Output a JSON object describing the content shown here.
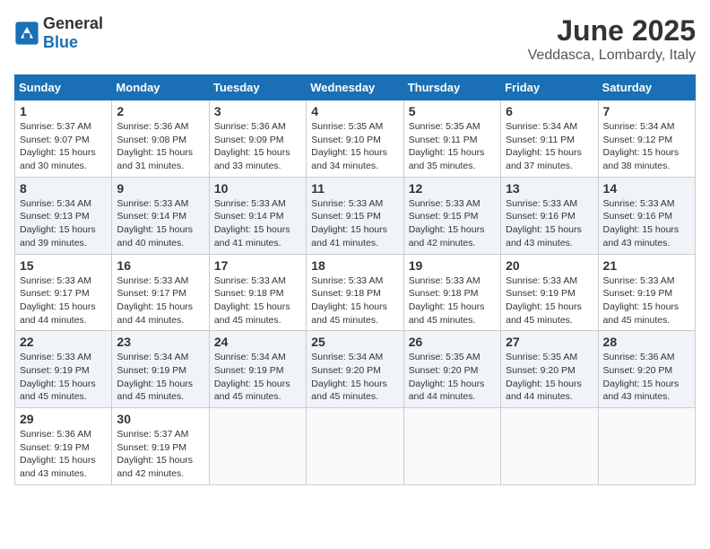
{
  "logo": {
    "general": "General",
    "blue": "Blue"
  },
  "title": {
    "month": "June 2025",
    "location": "Veddasca, Lombardy, Italy"
  },
  "calendar": {
    "headers": [
      "Sunday",
      "Monday",
      "Tuesday",
      "Wednesday",
      "Thursday",
      "Friday",
      "Saturday"
    ],
    "weeks": [
      [
        {
          "day": "1",
          "sunrise": "Sunrise: 5:37 AM",
          "sunset": "Sunset: 9:07 PM",
          "daylight": "Daylight: 15 hours and 30 minutes."
        },
        {
          "day": "2",
          "sunrise": "Sunrise: 5:36 AM",
          "sunset": "Sunset: 9:08 PM",
          "daylight": "Daylight: 15 hours and 31 minutes."
        },
        {
          "day": "3",
          "sunrise": "Sunrise: 5:36 AM",
          "sunset": "Sunset: 9:09 PM",
          "daylight": "Daylight: 15 hours and 33 minutes."
        },
        {
          "day": "4",
          "sunrise": "Sunrise: 5:35 AM",
          "sunset": "Sunset: 9:10 PM",
          "daylight": "Daylight: 15 hours and 34 minutes."
        },
        {
          "day": "5",
          "sunrise": "Sunrise: 5:35 AM",
          "sunset": "Sunset: 9:11 PM",
          "daylight": "Daylight: 15 hours and 35 minutes."
        },
        {
          "day": "6",
          "sunrise": "Sunrise: 5:34 AM",
          "sunset": "Sunset: 9:11 PM",
          "daylight": "Daylight: 15 hours and 37 minutes."
        },
        {
          "day": "7",
          "sunrise": "Sunrise: 5:34 AM",
          "sunset": "Sunset: 9:12 PM",
          "daylight": "Daylight: 15 hours and 38 minutes."
        }
      ],
      [
        {
          "day": "8",
          "sunrise": "Sunrise: 5:34 AM",
          "sunset": "Sunset: 9:13 PM",
          "daylight": "Daylight: 15 hours and 39 minutes."
        },
        {
          "day": "9",
          "sunrise": "Sunrise: 5:33 AM",
          "sunset": "Sunset: 9:14 PM",
          "daylight": "Daylight: 15 hours and 40 minutes."
        },
        {
          "day": "10",
          "sunrise": "Sunrise: 5:33 AM",
          "sunset": "Sunset: 9:14 PM",
          "daylight": "Daylight: 15 hours and 41 minutes."
        },
        {
          "day": "11",
          "sunrise": "Sunrise: 5:33 AM",
          "sunset": "Sunset: 9:15 PM",
          "daylight": "Daylight: 15 hours and 41 minutes."
        },
        {
          "day": "12",
          "sunrise": "Sunrise: 5:33 AM",
          "sunset": "Sunset: 9:15 PM",
          "daylight": "Daylight: 15 hours and 42 minutes."
        },
        {
          "day": "13",
          "sunrise": "Sunrise: 5:33 AM",
          "sunset": "Sunset: 9:16 PM",
          "daylight": "Daylight: 15 hours and 43 minutes."
        },
        {
          "day": "14",
          "sunrise": "Sunrise: 5:33 AM",
          "sunset": "Sunset: 9:16 PM",
          "daylight": "Daylight: 15 hours and 43 minutes."
        }
      ],
      [
        {
          "day": "15",
          "sunrise": "Sunrise: 5:33 AM",
          "sunset": "Sunset: 9:17 PM",
          "daylight": "Daylight: 15 hours and 44 minutes."
        },
        {
          "day": "16",
          "sunrise": "Sunrise: 5:33 AM",
          "sunset": "Sunset: 9:17 PM",
          "daylight": "Daylight: 15 hours and 44 minutes."
        },
        {
          "day": "17",
          "sunrise": "Sunrise: 5:33 AM",
          "sunset": "Sunset: 9:18 PM",
          "daylight": "Daylight: 15 hours and 45 minutes."
        },
        {
          "day": "18",
          "sunrise": "Sunrise: 5:33 AM",
          "sunset": "Sunset: 9:18 PM",
          "daylight": "Daylight: 15 hours and 45 minutes."
        },
        {
          "day": "19",
          "sunrise": "Sunrise: 5:33 AM",
          "sunset": "Sunset: 9:18 PM",
          "daylight": "Daylight: 15 hours and 45 minutes."
        },
        {
          "day": "20",
          "sunrise": "Sunrise: 5:33 AM",
          "sunset": "Sunset: 9:19 PM",
          "daylight": "Daylight: 15 hours and 45 minutes."
        },
        {
          "day": "21",
          "sunrise": "Sunrise: 5:33 AM",
          "sunset": "Sunset: 9:19 PM",
          "daylight": "Daylight: 15 hours and 45 minutes."
        }
      ],
      [
        {
          "day": "22",
          "sunrise": "Sunrise: 5:33 AM",
          "sunset": "Sunset: 9:19 PM",
          "daylight": "Daylight: 15 hours and 45 minutes."
        },
        {
          "day": "23",
          "sunrise": "Sunrise: 5:34 AM",
          "sunset": "Sunset: 9:19 PM",
          "daylight": "Daylight: 15 hours and 45 minutes."
        },
        {
          "day": "24",
          "sunrise": "Sunrise: 5:34 AM",
          "sunset": "Sunset: 9:19 PM",
          "daylight": "Daylight: 15 hours and 45 minutes."
        },
        {
          "day": "25",
          "sunrise": "Sunrise: 5:34 AM",
          "sunset": "Sunset: 9:20 PM",
          "daylight": "Daylight: 15 hours and 45 minutes."
        },
        {
          "day": "26",
          "sunrise": "Sunrise: 5:35 AM",
          "sunset": "Sunset: 9:20 PM",
          "daylight": "Daylight: 15 hours and 44 minutes."
        },
        {
          "day": "27",
          "sunrise": "Sunrise: 5:35 AM",
          "sunset": "Sunset: 9:20 PM",
          "daylight": "Daylight: 15 hours and 44 minutes."
        },
        {
          "day": "28",
          "sunrise": "Sunrise: 5:36 AM",
          "sunset": "Sunset: 9:20 PM",
          "daylight": "Daylight: 15 hours and 43 minutes."
        }
      ],
      [
        {
          "day": "29",
          "sunrise": "Sunrise: 5:36 AM",
          "sunset": "Sunset: 9:19 PM",
          "daylight": "Daylight: 15 hours and 43 minutes."
        },
        {
          "day": "30",
          "sunrise": "Sunrise: 5:37 AM",
          "sunset": "Sunset: 9:19 PM",
          "daylight": "Daylight: 15 hours and 42 minutes."
        },
        null,
        null,
        null,
        null,
        null
      ]
    ]
  }
}
